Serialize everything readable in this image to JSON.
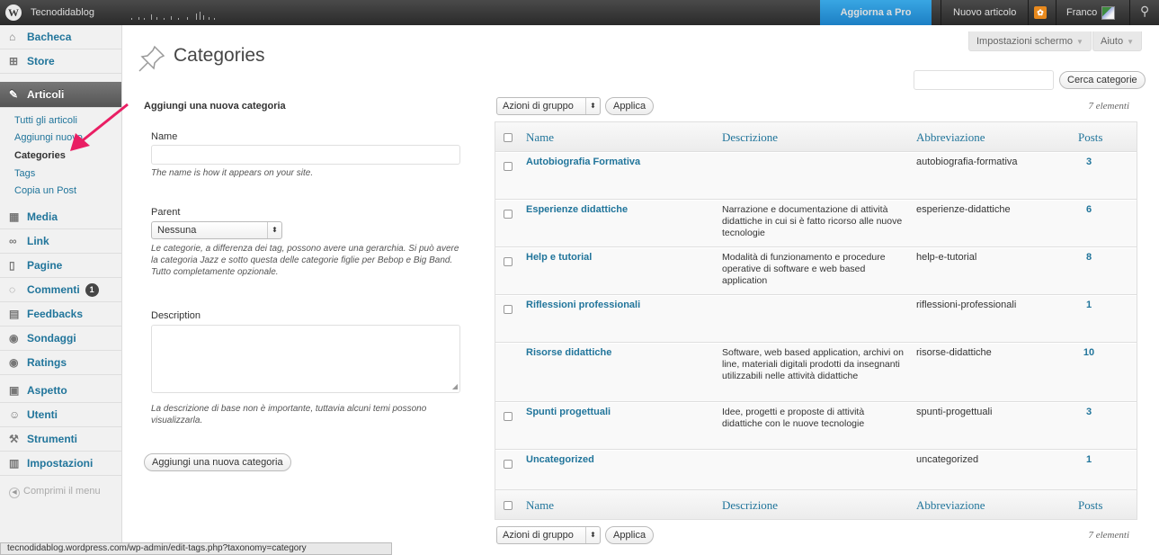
{
  "adminbar": {
    "site_name": "Tecnodidablog",
    "upgrade": "Aggiorna a Pro",
    "new_post": "Nuovo articolo",
    "user": "Franco"
  },
  "screen": {
    "options": "Impostazioni schermo",
    "help": "Aiuto"
  },
  "sidebar": {
    "dashboard": "Bacheca",
    "store": "Store",
    "posts": "Articoli",
    "sub": [
      "Tutti gli articoli",
      "Aggiungi nuovo",
      "Categories",
      "Tags",
      "Copia un Post"
    ],
    "media": "Media",
    "links": "Link",
    "pages": "Pagine",
    "comments": "Commenti",
    "comments_count": "1",
    "feedbacks": "Feedbacks",
    "polls": "Sondaggi",
    "ratings": "Ratings",
    "appearance": "Aspetto",
    "users": "Utenti",
    "tools": "Strumenti",
    "settings": "Impostazioni",
    "collapse": "Comprimi il menu"
  },
  "page": {
    "title": "Categories"
  },
  "search": {
    "button": "Cerca categorie",
    "placeholder": ""
  },
  "form": {
    "title": "Aggiungi una nuova categoria",
    "name_label": "Name",
    "name_help": "The name is how it appears on your site.",
    "parent_label": "Parent",
    "parent_value": "Nessuna",
    "parent_help": "Le categorie, a differenza dei tag, possono avere una gerarchia. Si può avere la categoria Jazz e sotto questa delle categorie figlie per Bebop e Big Band. Tutto completamente opzionale.",
    "description_label": "Description",
    "description_help": "La descrizione di base non è importante, tuttavia alcuni temi possono visualizzarla.",
    "submit": "Aggiungi una nuova categoria"
  },
  "bulk": {
    "label": "Azioni di gruppo",
    "apply": "Applica",
    "count": "7 elementi"
  },
  "table": {
    "columns": {
      "name": "Name",
      "description": "Descrizione",
      "slug": "Abbreviazione",
      "posts": "Posts"
    },
    "rows": [
      {
        "name": "Autobiografia Formativa",
        "description": "",
        "slug": "autobiografia-formativa",
        "posts": "3"
      },
      {
        "name": "Esperienze didattiche",
        "description": "Narrazione e documentazione di attività didattiche in cui si è fatto ricorso alle nuove tecnologie",
        "slug": "esperienze-didattiche",
        "posts": "6"
      },
      {
        "name": "Help e tutorial",
        "description": "Modalità di funzionamento e procedure operative di software e web based application",
        "slug": "help-e-tutorial",
        "posts": "8"
      },
      {
        "name": "Riflessioni professionali",
        "description": "",
        "slug": "riflessioni-professionali",
        "posts": "1"
      },
      {
        "name": "Risorse didattiche",
        "description": "Software, web based application, archivi on line, materiali digitali prodotti da insegnanti utilizzabili nelle attività didattiche",
        "slug": "risorse-didattiche",
        "posts": "10"
      },
      {
        "name": "Spunti progettuali",
        "description": "Idee, progetti e proposte di attività didattiche con le nuove tecnologie",
        "slug": "spunti-progettuali",
        "posts": "3"
      },
      {
        "name": "Uncategorized",
        "description": "",
        "slug": "uncategorized",
        "posts": "1"
      }
    ]
  },
  "statusbar": {
    "url": "tecnodidablog.wordpress.com/wp-admin/edit-tags.php?taxonomy=category"
  },
  "colors": {
    "link": "#21759b",
    "accent": "#e91e63",
    "upgrade": "#2b8fd4"
  }
}
